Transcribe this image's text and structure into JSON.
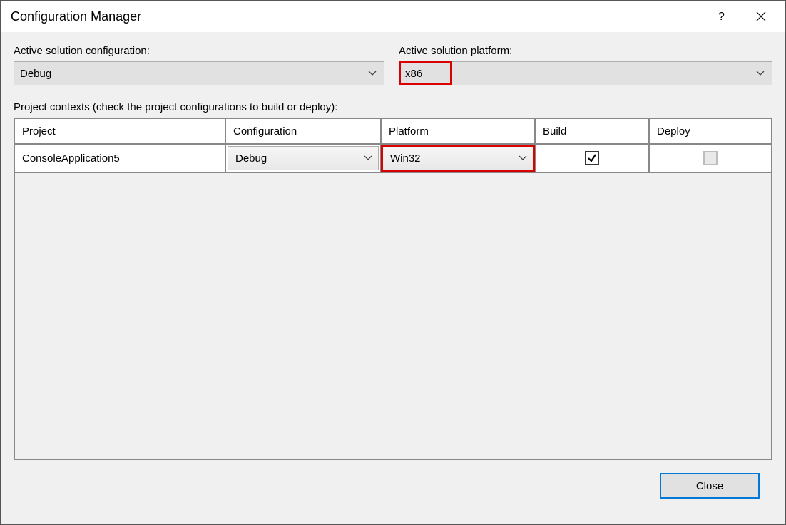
{
  "window": {
    "title": "Configuration Manager"
  },
  "fields": {
    "config_label": "Active solution configuration:",
    "config_value": "Debug",
    "platform_label": "Active solution platform:",
    "platform_value": "x86"
  },
  "contexts_label": "Project contexts (check the project configurations to build or deploy):",
  "grid": {
    "headers": {
      "project": "Project",
      "configuration": "Configuration",
      "platform": "Platform",
      "build": "Build",
      "deploy": "Deploy"
    },
    "rows": [
      {
        "project": "ConsoleApplication5",
        "configuration": "Debug",
        "platform": "Win32",
        "build_checked": true,
        "deploy_enabled": false
      }
    ]
  },
  "footer": {
    "close_label": "Close"
  }
}
